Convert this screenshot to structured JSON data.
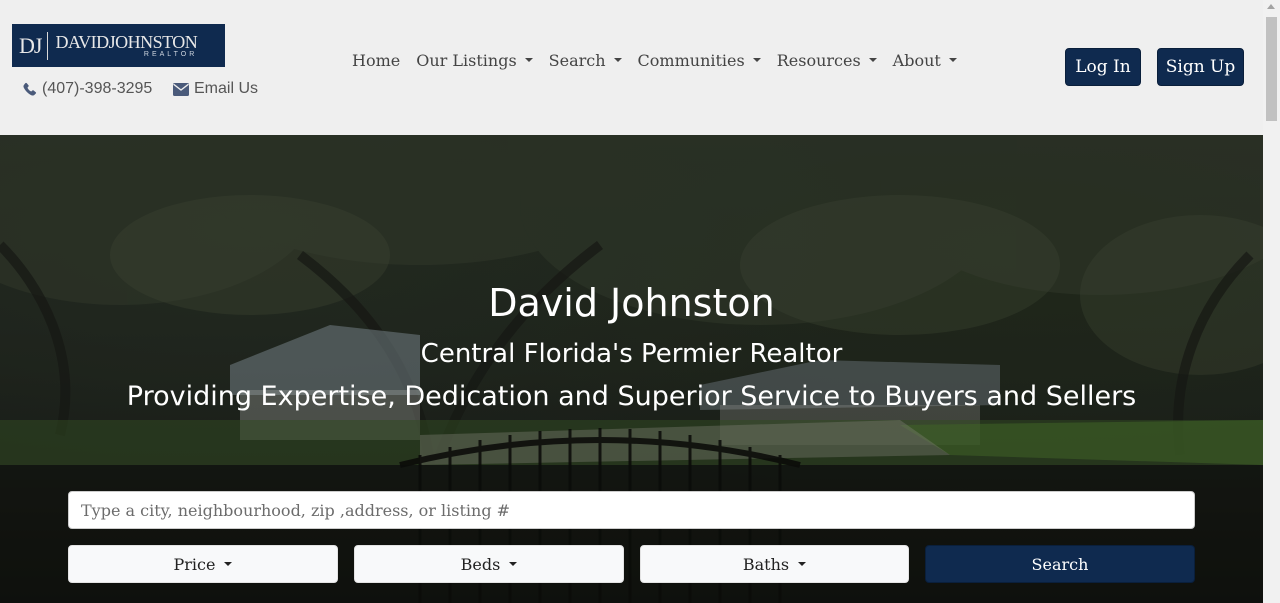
{
  "logo": {
    "initials": "DJ",
    "name": "DAVIDJOHNSTON",
    "subtitle": "REALTOR"
  },
  "contact": {
    "phone": "(407)-398-3295",
    "email_label": "Email Us",
    "phone_icon": "phone-icon",
    "email_icon": "envelope-icon"
  },
  "nav": {
    "home": "Home",
    "listings": "Our Listings",
    "search": "Search",
    "communities": "Communities",
    "resources": "Resources",
    "about": "About"
  },
  "auth": {
    "login": "Log In",
    "signup": "Sign Up"
  },
  "hero": {
    "title": "David Johnston",
    "subtitle": "Central Florida's Permier Realtor",
    "tagline": "Providing Expertise, Dedication and Superior Service to Buyers and Sellers"
  },
  "search": {
    "placeholder": "Type a city, neighbourhood, zip ,address, or listing #",
    "price_label": "Price",
    "beds_label": "Beds",
    "baths_label": "Baths",
    "button_label": "Search"
  },
  "colors": {
    "brand": "#0f2a4f",
    "header_bg": "#efefef",
    "filter_bg": "#f8f9fa"
  }
}
